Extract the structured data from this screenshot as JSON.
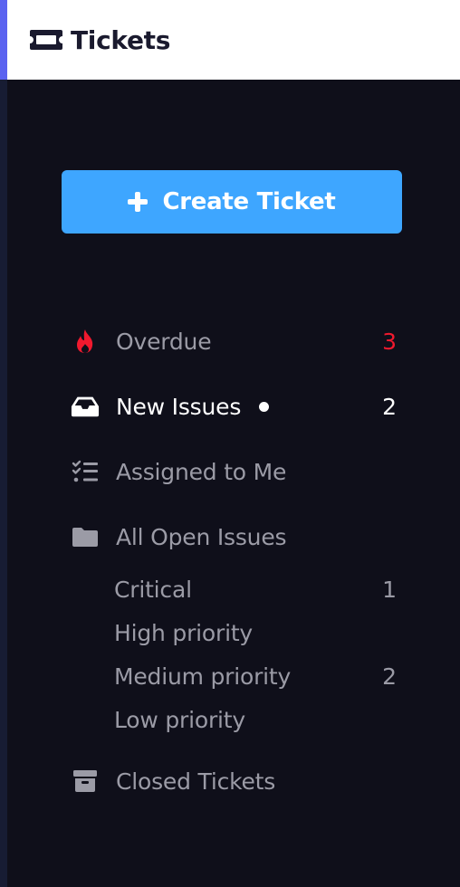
{
  "header": {
    "title": "Tickets",
    "icon": "ticket-icon"
  },
  "create_button": {
    "label": "Create Ticket",
    "icon": "plus-icon",
    "color": "#3ea6ff"
  },
  "colors": {
    "sidebar_bg": "#0f0f1a",
    "accent": "#5b63f0",
    "danger": "#f0192e",
    "muted_text": "#9b9ba6"
  },
  "nav": {
    "overdue": {
      "label": "Overdue",
      "count": "3",
      "icon": "fire-icon"
    },
    "new_issues": {
      "label": "New Issues",
      "count": "2",
      "icon": "inbox-icon",
      "unread": true
    },
    "assigned": {
      "label": "Assigned to Me",
      "icon": "task-list-icon"
    },
    "all_open": {
      "label": "All Open Issues",
      "icon": "folder-icon"
    },
    "priorities": [
      {
        "label": "Critical",
        "count": "1"
      },
      {
        "label": "High priority",
        "count": ""
      },
      {
        "label": "Medium priority",
        "count": "2"
      },
      {
        "label": "Low priority",
        "count": ""
      }
    ],
    "closed": {
      "label": "Closed Tickets",
      "icon": "archive-icon"
    }
  }
}
